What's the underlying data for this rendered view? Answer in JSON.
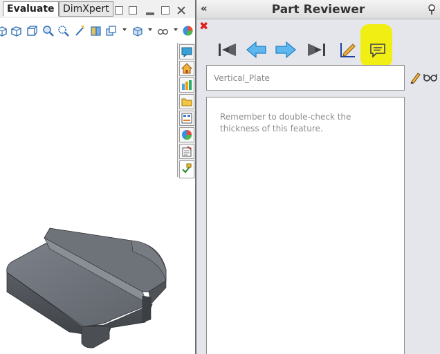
{
  "tabs": [
    {
      "label": "Evaluate",
      "active": true
    },
    {
      "label": "DimXpert",
      "active": false
    }
  ],
  "panel": {
    "title": "Part Reviewer",
    "collapse_icon": "«",
    "close_icon": "✖",
    "feature_name": "Vertical_Plate",
    "comment": "Remember to double-check the thickness of this feature.",
    "highlight_color": "#f0ee12"
  },
  "nav_icons": [
    "first-icon",
    "previous-icon",
    "next-icon",
    "last-icon",
    "edit-comment-icon",
    "comment-icon"
  ],
  "toolbar_icons": [
    "zoom-to-fit-icon",
    "view-cube-icon",
    "standard-view-icon",
    "zoom-area-icon",
    "zoom-select-icon",
    "magic-wand-icon",
    "section-view-icon",
    "display-state-icon",
    "view-orientation-icon",
    "display-style-icon",
    "hide-show-icon",
    "appearance-icon"
  ],
  "task_pane_icons": [
    "resources-icon",
    "home-icon",
    "design-library-icon",
    "file-explorer-icon",
    "view-palette-icon",
    "appearances-icon",
    "custom-properties-icon",
    "part-reviewer-icon"
  ]
}
